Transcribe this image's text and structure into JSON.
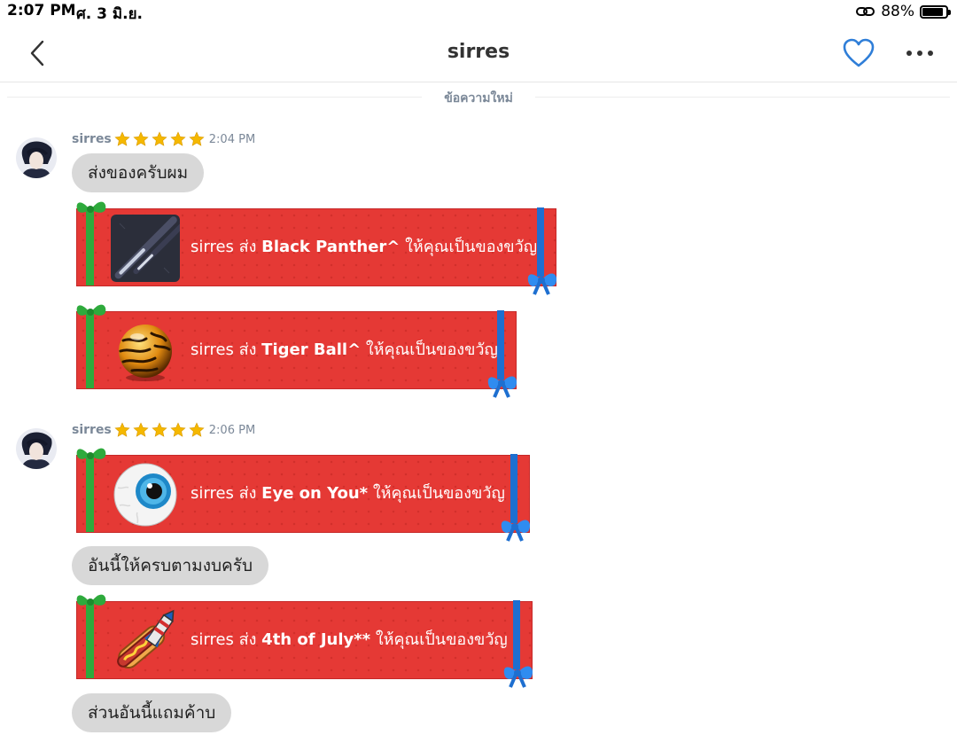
{
  "status_bar": {
    "time": "2:07 PM",
    "date": "ศ. 3 มิ.ย.",
    "battery_pct": "88%",
    "battery_level": 0.88
  },
  "header": {
    "title": "sirres",
    "back_icon": "chevron-left-icon",
    "favorite_icon": "heart-outline-icon",
    "more_icon": "more-horizontal-icon",
    "accent_color": "#2f7ed8"
  },
  "divider_label": "ข้อความใหม่",
  "messages": [
    {
      "sender": "sirres",
      "stars": 5,
      "time": "2:04 PM",
      "items": [
        {
          "type": "text",
          "text": "ส่งของครับผม"
        },
        {
          "type": "gift",
          "sender": "sirres",
          "verb": "ส่ง",
          "item": "Black Panther^",
          "suffix": "ให้คุณเป็นของขวัญ",
          "icon": "cue-stick-icon"
        },
        {
          "type": "gift",
          "sender": "sirres",
          "verb": "ส่ง",
          "item": "Tiger Ball^",
          "suffix": "ให้คุณเป็นของขวัญ",
          "icon": "tiger-ball-icon"
        }
      ]
    },
    {
      "sender": "sirres",
      "stars": 5,
      "time": "2:06 PM",
      "items": [
        {
          "type": "gift",
          "sender": "sirres",
          "verb": "ส่ง",
          "item": "Eye on You*",
          "suffix": "ให้คุณเป็นของขวัญ",
          "icon": "eyeball-icon"
        },
        {
          "type": "text",
          "text": "อันนี้ให้ครบตามงบครับ"
        },
        {
          "type": "gift",
          "sender": "sirres",
          "verb": "ส่ง",
          "item": "4th of July**",
          "suffix": "ให้คุณเป็นของขวัญ",
          "icon": "hotdog-rocket-icon"
        },
        {
          "type": "text",
          "text": "ส่วนอันนี้แถมค้าบ"
        }
      ]
    }
  ],
  "colors": {
    "gift_red": "#e53935",
    "ribbon_green": "#2eaa3c",
    "ribbon_blue": "#1e6fd0",
    "bubble_gray": "#d8d8d8",
    "meta_gray": "#7b8898",
    "star_gold": "#f5b800"
  }
}
